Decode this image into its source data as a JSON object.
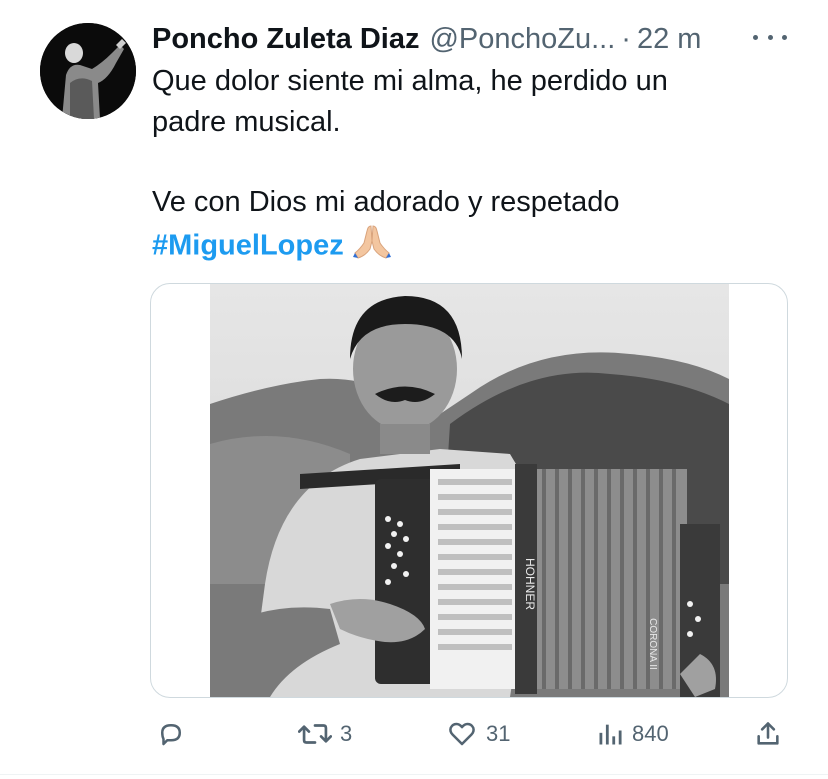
{
  "tweet": {
    "author_name": "Poncho Zuleta Diaz",
    "author_handle": "@PonchoZu...",
    "separator": "·",
    "time": "22 m",
    "text_line1": "Que dolor siente mi alma, he perdido un",
    "text_line2": "padre musical.",
    "text_line3": "Ve con Dios mi adorado y respetado",
    "hashtag": "#MiguelLopez",
    "hashtag_emoji": "folded-hands",
    "media_photo_text": {
      "accordion_brand": "HOHNER",
      "accordion_model": "CORONA II"
    }
  },
  "actions": {
    "reply_count": "",
    "retweet_count": "3",
    "like_count": "31",
    "views_count": "840"
  },
  "icons": [
    "reply-icon",
    "retweet-icon",
    "like-icon",
    "views-icon",
    "share-icon",
    "more-icon",
    "folded-hands-icon"
  ],
  "colors": {
    "link": "#1d9bf0",
    "secondary": "#536471",
    "primary_text": "#0f1419",
    "border": "#cfd9de"
  }
}
